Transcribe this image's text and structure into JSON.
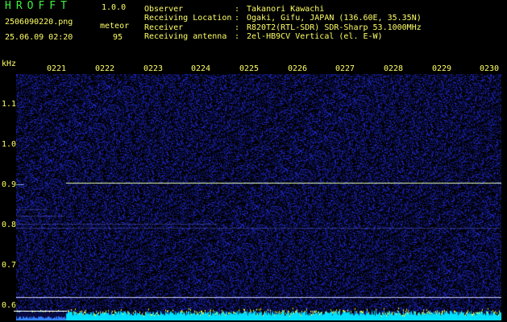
{
  "header": {
    "app_title": "HROFFT",
    "version": "1.0.0",
    "filename": "2506090220.png",
    "datetime": "25.06.09 02:20",
    "meteor_label": "meteor",
    "meteor_count": "95"
  },
  "info": [
    {
      "label": "Observer",
      "value": "Takanori Kawachi"
    },
    {
      "label": "Receiving Location",
      "value": "Ogaki, Gifu, JAPAN (136.60E, 35.35N)"
    },
    {
      "label": "Receiver",
      "value": "R820T2(RTL-SDR) SDR-Sharp 53.1000MHz"
    },
    {
      "label": "Receiving antenna",
      "value": "2el-HB9CV Vertical (el. E-W)"
    }
  ],
  "axis": {
    "unit": "kHz",
    "y_ticks": [
      "1.1",
      "1.0",
      "0.9",
      "0.8",
      "0.7",
      "0.6"
    ],
    "x_ticks": [
      "0221",
      "0222",
      "0223",
      "0224",
      "0225",
      "0226",
      "0227",
      "0228",
      "0229",
      "0230"
    ]
  },
  "colors": {
    "background": "#000000",
    "text": "#ffff66",
    "title": "#3df23d",
    "noise": "#1a2a8a",
    "carrier": "#ffff88",
    "baseline": "#00ffff"
  }
}
